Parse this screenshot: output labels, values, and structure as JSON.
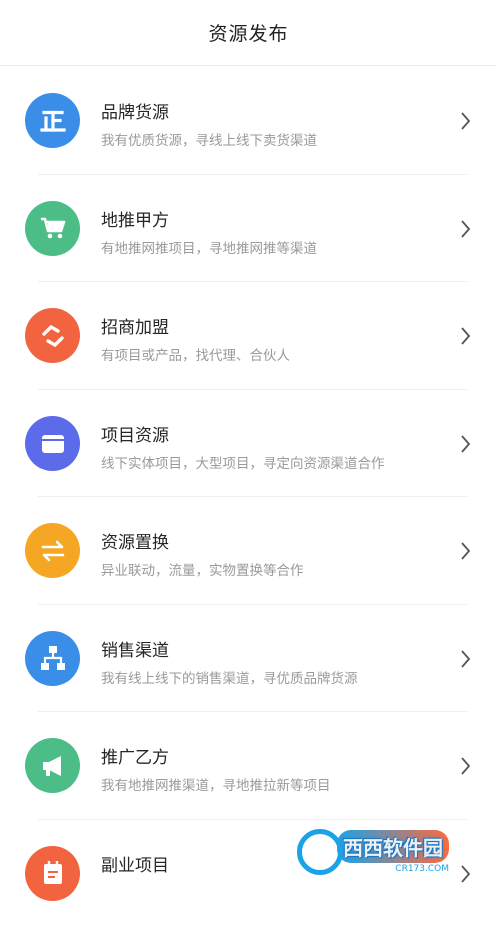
{
  "header": {
    "title": "资源发布"
  },
  "items": [
    {
      "name": "品牌货源",
      "desc": "我有优质货源，寻线上线下卖货渠道",
      "color": "#3b8ee8",
      "icon": "zheng-icon"
    },
    {
      "name": "地推甲方",
      "desc": "有地推网推项目，寻地推网推等渠道",
      "color": "#4cbd86",
      "icon": "cart-icon"
    },
    {
      "name": "招商加盟",
      "desc": "有项目或产品，找代理、合伙人",
      "color": "#f2643f",
      "icon": "handshake-icon"
    },
    {
      "name": "项目资源",
      "desc": "线下实体项目，大型项目，寻定向资源渠道合作",
      "color": "#5b6bea",
      "icon": "folder-icon"
    },
    {
      "name": "资源置换",
      "desc": "异业联动，流量，实物置换等合作",
      "color": "#f5a623",
      "icon": "exchange-icon"
    },
    {
      "name": "销售渠道",
      "desc": "我有线上线下的销售渠道，寻优质品牌货源",
      "color": "#3b8ee8",
      "icon": "network-icon"
    },
    {
      "name": "推广乙方",
      "desc": "我有地推网推渠道，寻地推拉新等项目",
      "color": "#4cbd86",
      "icon": "megaphone-icon"
    },
    {
      "name": "副业项目",
      "desc": "",
      "color": "#f2643f",
      "icon": "calendar-icon"
    }
  ],
  "watermark": {
    "main": "西西软件园",
    "sub": "CR173.COM"
  }
}
